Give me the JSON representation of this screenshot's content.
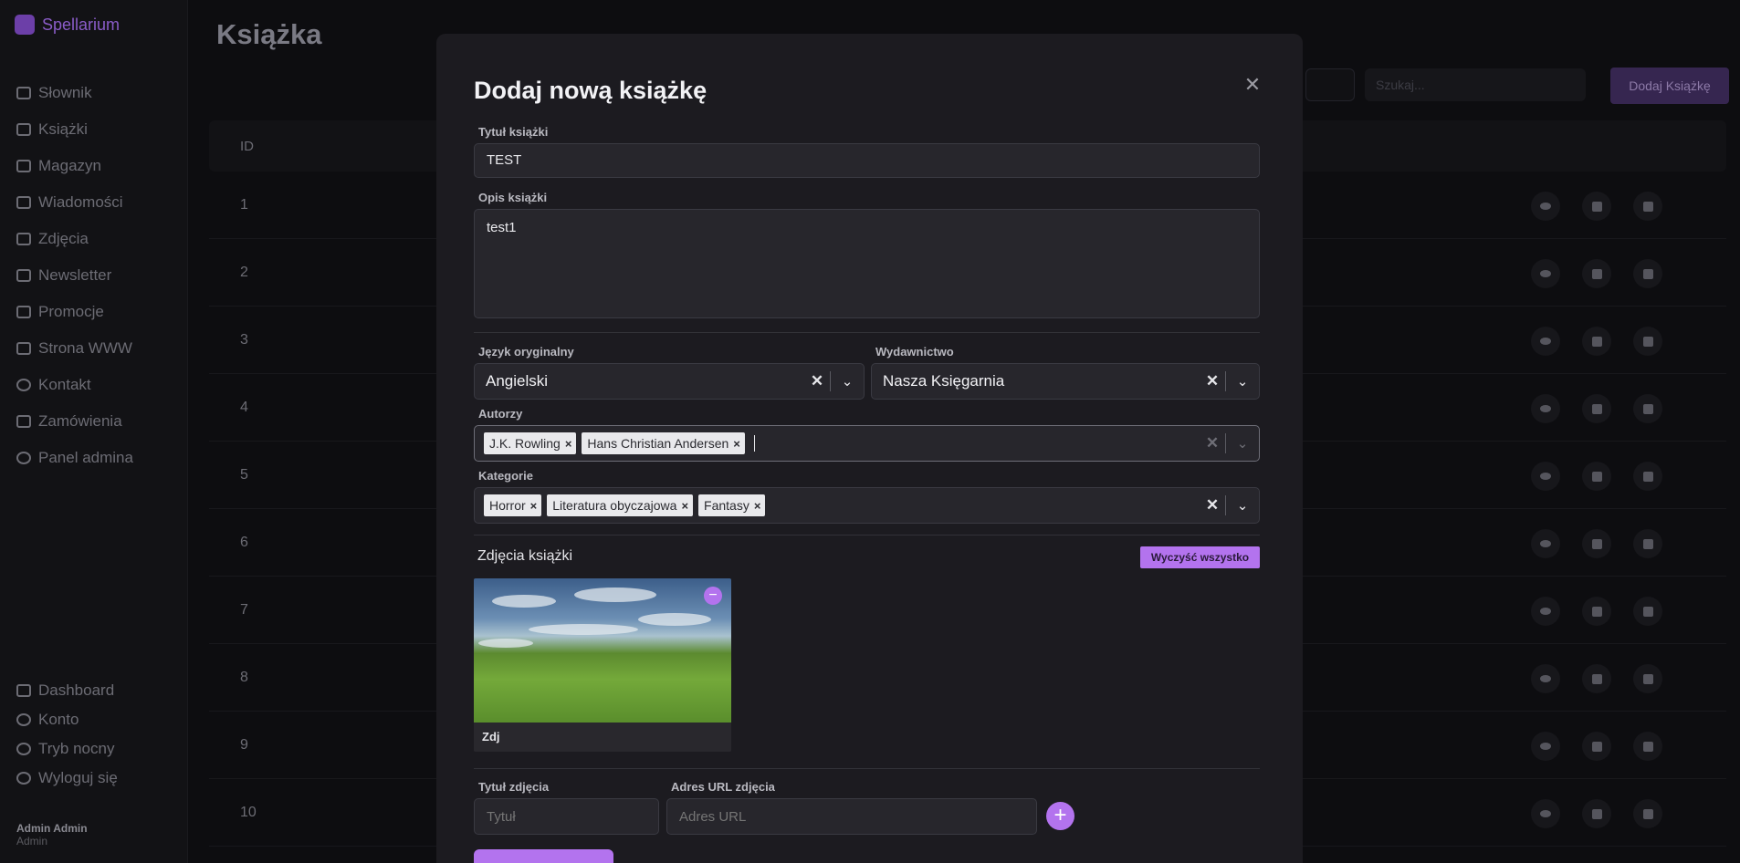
{
  "brand": {
    "name": "Spellarium"
  },
  "sidebar": {
    "items": [
      {
        "label": "Słownik",
        "icon": "book-icon"
      },
      {
        "label": "Książki",
        "icon": "books-icon"
      },
      {
        "label": "Magazyn",
        "icon": "warehouse-icon"
      },
      {
        "label": "Wiadomości",
        "icon": "newspaper-icon"
      },
      {
        "label": "Zdjęcia",
        "icon": "image-icon"
      },
      {
        "label": "Newsletter",
        "icon": "newsletter-icon"
      },
      {
        "label": "Promocje",
        "icon": "tag-icon"
      },
      {
        "label": "Strona WWW",
        "icon": "web-icon"
      },
      {
        "label": "Kontakt",
        "icon": "chat-icon"
      },
      {
        "label": "Zamówienia",
        "icon": "box-icon"
      },
      {
        "label": "Panel admina",
        "icon": "admin-icon"
      }
    ],
    "bottom": [
      {
        "label": "Dashboard",
        "icon": "dashboard-icon"
      },
      {
        "label": "Konto",
        "icon": "user-icon"
      },
      {
        "label": "Tryb nocny",
        "icon": "moon-icon"
      },
      {
        "label": "Wyloguj się",
        "icon": "logout-icon"
      }
    ],
    "user": {
      "name": "Admin Admin",
      "role": "Admin"
    }
  },
  "page": {
    "title": "Książka",
    "search_placeholder": "Szukaj...",
    "add_button": "Dodaj Książkę",
    "table_header": "ID",
    "rows": [
      "1",
      "2",
      "3",
      "4",
      "5",
      "6",
      "7",
      "8",
      "9",
      "10"
    ]
  },
  "modal": {
    "title": "Dodaj nową książkę",
    "title_label": "Tytuł książki",
    "title_value": "TEST",
    "description_label": "Opis książki",
    "description_value": "test1",
    "language_label": "Język oryginalny",
    "language_value": "Angielski",
    "publisher_label": "Wydawnictwo",
    "publisher_value": "Nasza Księgarnia",
    "authors_label": "Autorzy",
    "authors": [
      "J.K. Rowling",
      "Hans Christian Andersen"
    ],
    "categories_label": "Kategorie",
    "categories": [
      "Horror",
      "Literatura obyczajowa",
      "Fantasy"
    ],
    "photos_label": "Zdjęcia książki",
    "clear_all": "Wyczyść wszystko",
    "photo_caption": "Zdj",
    "photo_title_label": "Tytuł zdjęcia",
    "photo_title_placeholder": "Tytuł",
    "photo_url_label": "Adres URL zdjęcia",
    "photo_url_placeholder": "Adres URL"
  },
  "colors": {
    "accent": "#b373ee",
    "modal_bg": "#1c1b20",
    "page_bg": "#0d0d10"
  }
}
